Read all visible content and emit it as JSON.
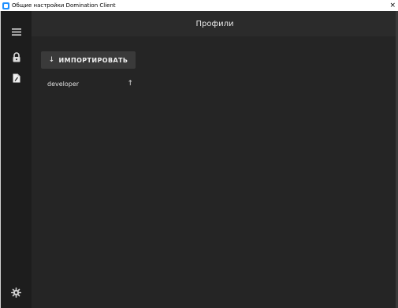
{
  "window": {
    "title": "Общие настройки Domination Client",
    "close_glyph": "×"
  },
  "sidebar": {
    "items": [
      {
        "icon": "hamburger-menu-icon"
      },
      {
        "icon": "lock-icon"
      },
      {
        "icon": "file-icon"
      },
      {
        "icon": "gear-icon"
      }
    ]
  },
  "header": {
    "title": "Профили"
  },
  "import_button": {
    "arrow": "↓",
    "label": "ИМПОРТИРОВАТЬ"
  },
  "profiles": [
    {
      "name": "developer",
      "action_glyph": "↑"
    }
  ],
  "colors": {
    "background": "#252525",
    "sidebar": "#1d1d1d",
    "header": "#2b2b2b",
    "button": "#3a3a3a",
    "text": "#e6e6e6"
  }
}
